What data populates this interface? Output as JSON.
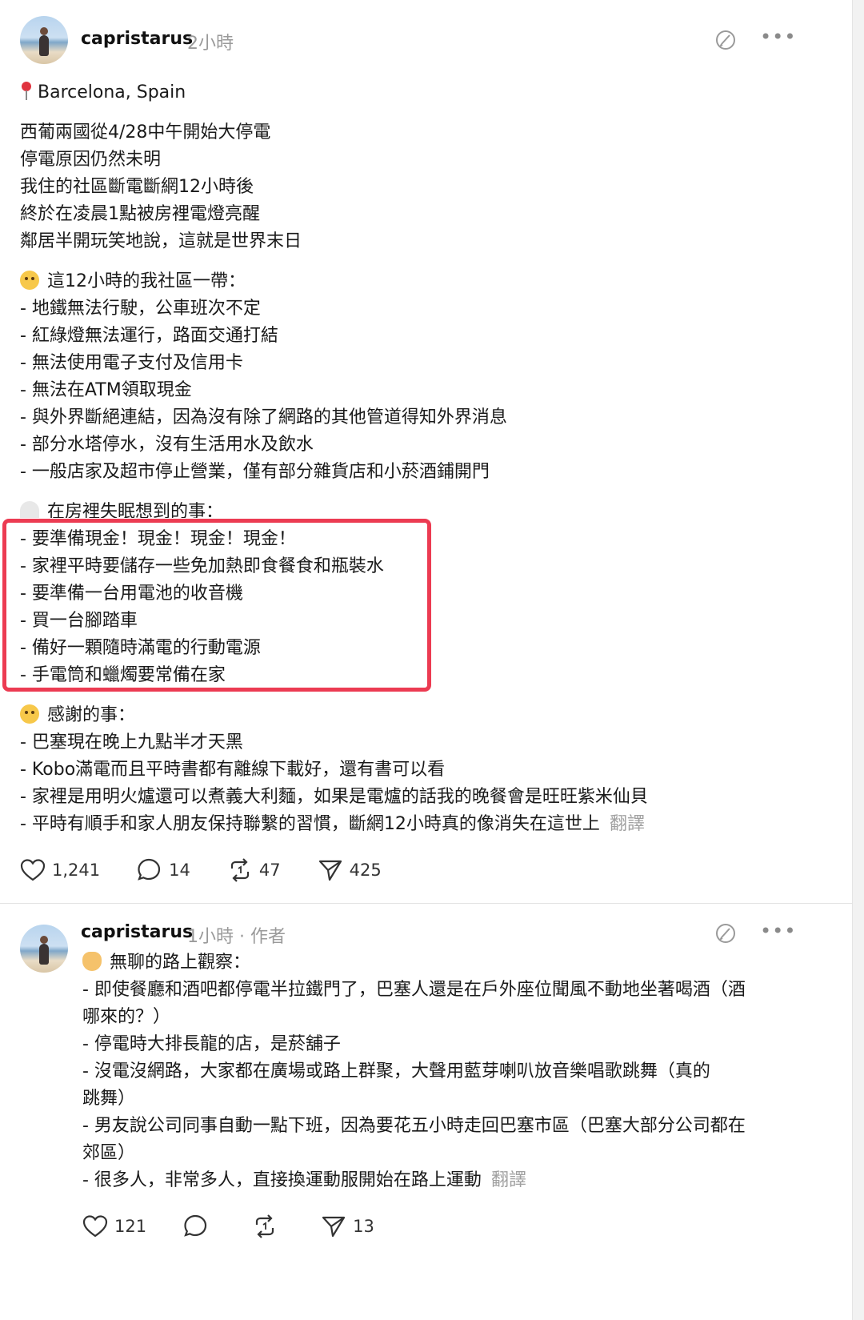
{
  "post1": {
    "username": "capristarus",
    "time": "2小時",
    "location": "Barcelona, Spain",
    "intro": [
      "西葡兩國從4/28中午開始大停電",
      "停電原因仍然未明",
      "我住的社區斷電斷網12小時後",
      "終於在凌晨1點被房裡電燈亮醒",
      "鄰居半開玩笑地說，這就是世界末日"
    ],
    "section1_title": "這12小時的我社區一帶：",
    "section1_items": [
      "- 地鐵無法行駛，公車班次不定",
      "- 紅綠燈無法運行，路面交通打結",
      "- 無法使用電子支付及信用卡",
      "- 無法在ATM領取現金",
      "- 與外界斷絕連結，因為沒有除了網路的其他管道得知外界消息",
      "- 部分水塔停水，沒有生活用水及飲水",
      "- 一般店家及超市停止營業，僅有部分雜貨店和小菸酒鋪開門"
    ],
    "section2_title": "在房裡失眠想到的事：",
    "section2_items": [
      "- 要準備現金！現金！現金！現金！",
      "- 家裡平時要儲存一些免加熱即食餐食和瓶裝水",
      "- 要準備一台用電池的收音機",
      "- 買一台腳踏車",
      "- 備好一顆隨時滿電的行動電源",
      "- 手電筒和蠟燭要常備在家"
    ],
    "section3_title": "感謝的事：",
    "section3_items": [
      "- 巴塞現在晚上九點半才天黑",
      "- Kobo滿電而且平時書都有離線下載好，還有書可以看",
      "- 家裡是用明火爐還可以煮義大利麵，如果是電爐的話我的晚餐會是旺旺紫米仙貝",
      "- 平時有順手和家人朋友保持聯繫的習慣，斷網12小時真的像消失在這世上"
    ],
    "translate": "翻譯",
    "likes": "1,241",
    "replies": "14",
    "reposts": "47",
    "shares": "425"
  },
  "post2": {
    "username": "capristarus",
    "time": "1小時",
    "author_tag": "· 作者",
    "title": "無聊的路上觀察：",
    "lines": [
      "- 即使餐廳和酒吧都停電半拉鐵門了，巴塞人還是在戶外座位聞風不動地坐著喝酒（酒",
      "哪來的？）",
      "- 停電時大排長龍的店，是菸舖子",
      "- 沒電沒網路，大家都在廣場或路上群聚，大聲用藍芽喇叭放音樂唱歌跳舞（真的",
      "跳舞）",
      "- 男友說公司同事自動一點下班，因為要花五小時走回巴塞市區（巴塞大部分公司都在",
      "郊區）",
      "- 很多人，非常多人，直接換運動服開始在路上運動"
    ],
    "translate": "翻譯",
    "likes": "121",
    "reposts": "",
    "shares": "13"
  },
  "icons": {
    "more": "more-horizontal-icon",
    "edit": "edit-circle-icon",
    "like": "heart-icon",
    "reply": "comment-icon",
    "repost": "repost-icon",
    "share": "send-icon"
  },
  "colors": {
    "highlight": "#ec3b52",
    "muted": "#9a9a9a"
  }
}
